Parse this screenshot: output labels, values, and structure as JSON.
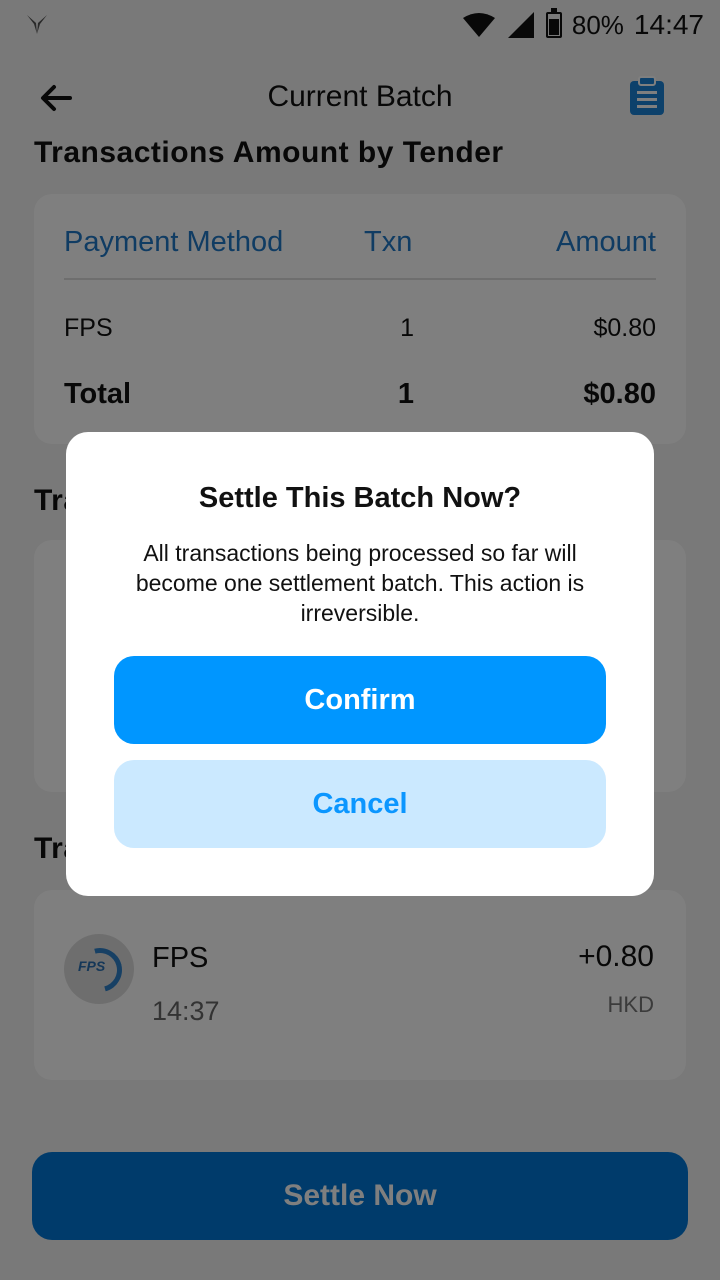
{
  "status_bar": {
    "battery": "80%",
    "time": "14:47"
  },
  "app_bar": {
    "title": "Current Batch"
  },
  "tender_section": {
    "title": "Transactions Amount by Tender",
    "headers": {
      "method": "Payment Method",
      "txn": "Txn",
      "amount": "Amount"
    },
    "rows": [
      {
        "method": "FPS",
        "txn": "1",
        "amount": "$0.80"
      }
    ],
    "total": {
      "label": "Total",
      "txn": "1",
      "amount": "$0.80"
    }
  },
  "second_section": {
    "title_fragment": "Tra"
  },
  "third_section": {
    "title_fragment": "Tra"
  },
  "transactions": [
    {
      "name": "FPS",
      "time": "14:37",
      "amount": "+0.80",
      "currency": "HKD",
      "logo_text": "FPS"
    }
  ],
  "bottom": {
    "settle_label": "Settle Now"
  },
  "dialog": {
    "title": "Settle This Batch Now?",
    "message": "All transactions being processed so far will become one settlement batch. This action is irreversible.",
    "confirm_label": "Confirm",
    "cancel_label": "Cancel"
  }
}
